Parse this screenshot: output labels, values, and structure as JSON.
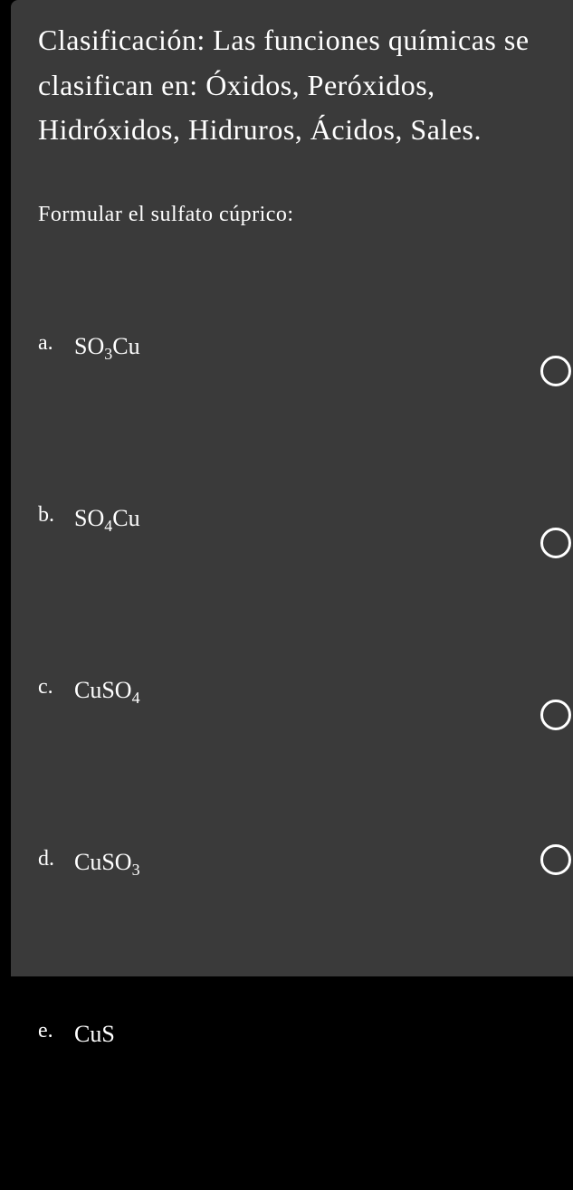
{
  "heading": "Clasificación: Las funciones químicas se clasifican en: Óxidos, Peróxidos, Hidróxidos, Hidruros, Ácidos, Sales.",
  "prompt": "Formular el sulfato cúprico:",
  "options": [
    {
      "letter": "a.",
      "formula_html": "SO<sub>3</sub>Cu",
      "plain": "SO3Cu"
    },
    {
      "letter": "b.",
      "formula_html": "SO<sub>4</sub>Cu",
      "plain": "SO4Cu"
    },
    {
      "letter": "c.",
      "formula_html": "CuSO<sub>4</sub>",
      "plain": "CuSO4"
    },
    {
      "letter": "d.",
      "formula_html": "CuSO<sub>3</sub>",
      "plain": "CuSO3"
    },
    {
      "letter": "e.",
      "formula_html": "CuS",
      "plain": "CuS"
    }
  ]
}
